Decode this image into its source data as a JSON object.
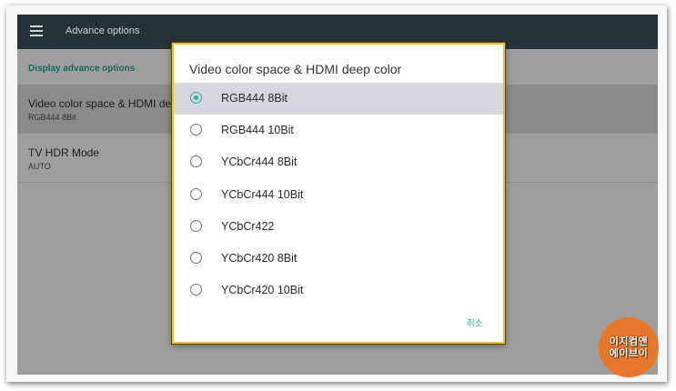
{
  "appbar": {
    "title": "Advance options",
    "menu_icon": "hamburger-menu-icon"
  },
  "section": {
    "header": "Display advance options"
  },
  "preferences": [
    {
      "title": "Video color space & HDMI dee",
      "summary": "RGB444 8Bit"
    },
    {
      "title": "TV HDR Mode",
      "summary": "AUTO"
    }
  ],
  "dialog": {
    "title": "Video color space & HDMI deep color",
    "options": [
      {
        "label": "RGB444 8Bit",
        "checked": true
      },
      {
        "label": "RGB444 10Bit",
        "checked": false
      },
      {
        "label": "YCbCr444 8Bit",
        "checked": false
      },
      {
        "label": "YCbCr444 10Bit",
        "checked": false
      },
      {
        "label": "YCbCr422",
        "checked": false
      },
      {
        "label": "YCbCr420 8Bit",
        "checked": false
      },
      {
        "label": "YCbCr420 10Bit",
        "checked": false
      }
    ],
    "cancel_label": "취소"
  },
  "watermark": {
    "line1": "이지컴앤",
    "line2": "에이브이"
  },
  "colors": {
    "accent": "#23b39c",
    "appbar": "#263238",
    "dialog_border": "#e8c52a",
    "watermark": "#e7782b"
  }
}
